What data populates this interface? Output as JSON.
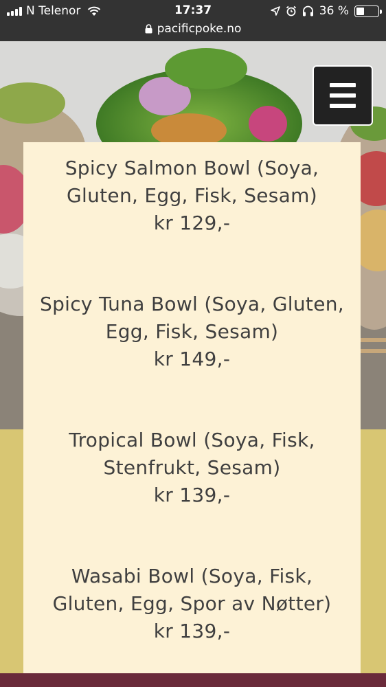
{
  "status_bar": {
    "carrier": "N Telenor",
    "time": "17:37",
    "battery": "36 %",
    "battery_level": 0.36
  },
  "browser": {
    "url": "pacificpoke.no"
  },
  "icons": {
    "signal": "signal-bars-icon",
    "wifi": "wifi-icon",
    "location": "location-arrow-icon",
    "alarm": "alarm-clock-icon",
    "headphones": "headphones-icon",
    "battery": "battery-icon",
    "lock": "lock-icon",
    "menu": "hamburger-menu-icon"
  },
  "colors": {
    "status_bar_bg": "#333333",
    "card_bg": "#fdf2d6",
    "band": "#d8c673",
    "text": "#3f3f3f",
    "menu_button": "#222222",
    "bottom_strip": "#6a2a3a"
  },
  "menu": {
    "items": [
      {
        "name": "Spicy Salmon Bowl (Soya, Gluten, Egg, Fisk, Sesam)",
        "price": "kr 129,-"
      },
      {
        "name": "Spicy Tuna Bowl (Soya, Gluten, Egg, Fisk, Sesam)",
        "price": "kr 149,-"
      },
      {
        "name": "Tropical Bowl (Soya, Fisk, Stenfrukt, Sesam)",
        "price": "kr 139,-"
      },
      {
        "name": "Wasabi Bowl (Soya, Fisk, Gluten, Egg, Spor av Nøtter)",
        "price": "kr 139,-"
      }
    ]
  }
}
